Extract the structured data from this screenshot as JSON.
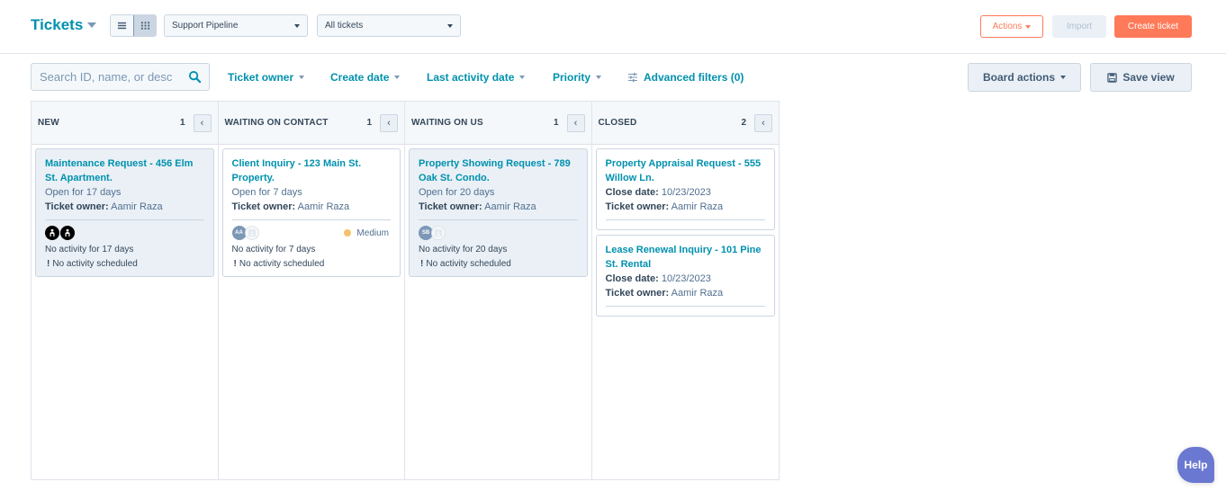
{
  "header": {
    "title": "Tickets",
    "view_toggle": {
      "list_label": "List view",
      "board_label": "Board view",
      "active": "board"
    },
    "pipeline_select": "Support Pipeline",
    "view_select": "All tickets",
    "actions_label": "Actions",
    "import_label": "Import",
    "create_label": "Create ticket"
  },
  "filters": {
    "search_placeholder": "Search ID, name, or desc",
    "ticket_owner": "Ticket owner",
    "create_date": "Create date",
    "last_activity_date": "Last activity date",
    "priority": "Priority",
    "advanced_filters": "Advanced filters (0)",
    "board_actions": "Board actions",
    "save_view": "Save view"
  },
  "labels": {
    "ticket_owner": "Ticket owner:",
    "close_date": "Close date:",
    "bang": "!"
  },
  "columns": [
    {
      "title": "NEW",
      "count": "1",
      "collapse_glyph": "‹",
      "cards": [
        {
          "title": "Maintenance Request - 456 Elm St. Apartment.",
          "status": "Open for 17 days",
          "owner": "Aamir Raza",
          "no_activity": "No activity for 17 days",
          "scheduled": "No activity scheduled"
        }
      ]
    },
    {
      "title": "WAITING ON CONTACT",
      "count": "1",
      "collapse_glyph": "‹",
      "cards": [
        {
          "title": "Client Inquiry - 123 Main St. Property.",
          "status": "Open for 7 days",
          "owner": "Aamir Raza",
          "avatar_initials": "AA",
          "priority": "Medium",
          "priority_color": "#f5c26b",
          "no_activity": "No activity for 7 days",
          "scheduled": "No activity scheduled"
        }
      ]
    },
    {
      "title": "WAITING ON US",
      "count": "1",
      "collapse_glyph": "‹",
      "cards": [
        {
          "title": "Property Showing Request - 789 Oak St. Condo.",
          "status": "Open for 20 days",
          "owner": "Aamir Raza",
          "avatar_initials": "SB",
          "no_activity": "No activity for 20 days",
          "scheduled": "No activity scheduled"
        }
      ]
    },
    {
      "title": "CLOSED",
      "count": "2",
      "collapse_glyph": "‹",
      "cards": [
        {
          "title": "Property Appraisal Request - 555 Willow Ln.",
          "close_date": "10/23/2023",
          "owner": "Aamir Raza"
        },
        {
          "title": "Lease Renewal Inquiry - 101 Pine St. Rental",
          "close_date": "10/23/2023",
          "owner": "Aamir Raza"
        }
      ]
    }
  ],
  "help_label": "Help",
  "colors": {
    "brand_link": "#0091ae",
    "primary_orange": "#ff7a59",
    "help_purple": "#6a78d1",
    "priority_medium": "#f5c26b"
  }
}
